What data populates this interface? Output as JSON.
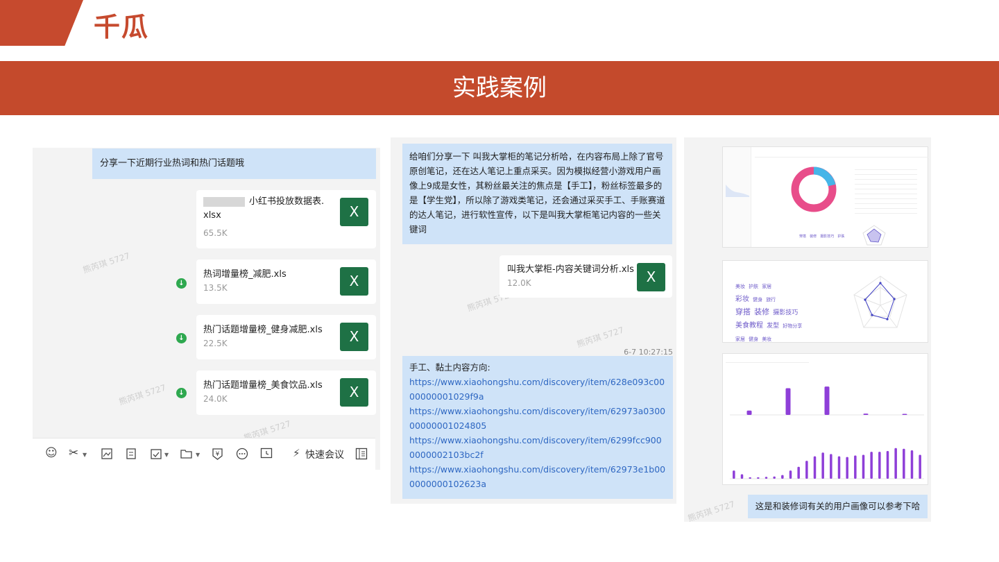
{
  "brand": {
    "name": "千瓜"
  },
  "banner": {
    "title": "实践案例"
  },
  "chat1": {
    "message": "分享一下近期行业热词和热门话题哦",
    "files": [
      {
        "name_line1": "小红书投放数据表.",
        "name_line2": "xlsx",
        "size": "65.5K"
      },
      {
        "name": "热词增量榜_减肥.xls",
        "size": "13.5K"
      },
      {
        "name": "热门话题增量榜_健身减肥.xls",
        "size": "22.5K"
      },
      {
        "name": "热门话题增量榜_美食饮品.xls",
        "size": "24.0K"
      }
    ],
    "excel_icon_label": "X",
    "download_glyph": "↓",
    "watermark": "熊芮琪 5727",
    "toolbar": {
      "quick_meeting": "快速会议"
    }
  },
  "chat2": {
    "message": "给咱们分享一下 叫我大掌柜的笔记分析哈，在内容布局上除了官号原创笔记，还在达人笔记上重点采买。因为模拟经营小游戏用户画像上9成是女性，其粉丝最关注的焦点是【手工】，粉丝标签最多的是【学生党】，所以除了游戏类笔记，还会通过采买手工、手账赛道的达人笔记，进行软性宣传，以下是叫我大掌柜笔记内容的一些关键词",
    "file": {
      "name": "叫我大掌柜-内容关键词分析.xls",
      "size": "12.0K"
    },
    "timestamp": "6-7 10:27:15",
    "links_title": "手工、黏土内容方向:",
    "links": [
      "https://www.xiaohongshu.com/discovery/item/628e093c0000000001029f9a",
      "https://www.xiaohongshu.com/discovery/item/62973a030000000001024805",
      "https://www.xiaohongshu.com/discovery/item/6299fcc9000000002103bc2f",
      "https://www.xiaohongshu.com/discovery/item/62973e1b000000000102623a"
    ]
  },
  "chat3": {
    "message": "这是和装修词有关的用户画像可以参考下哈",
    "wordcloud": [
      "穿搭",
      "装修",
      "摄影技巧",
      "美食教程",
      "发型",
      "护肤",
      "彩妆",
      "健身",
      "旅行",
      "美妆",
      "家居",
      "好物分享"
    ],
    "bar_values_top": [
      0.1,
      0.62,
      0.66,
      0.03,
      0.01
    ],
    "bar_values_bottom": [
      0.22,
      0.12,
      0.04,
      0.04,
      0.05,
      0.06,
      0.1,
      0.22,
      0.32,
      0.48,
      0.6,
      0.7,
      0.66,
      0.6,
      0.58,
      0.62,
      0.64,
      0.72,
      0.72,
      0.74,
      0.82,
      0.8,
      0.76,
      0.64
    ]
  }
}
